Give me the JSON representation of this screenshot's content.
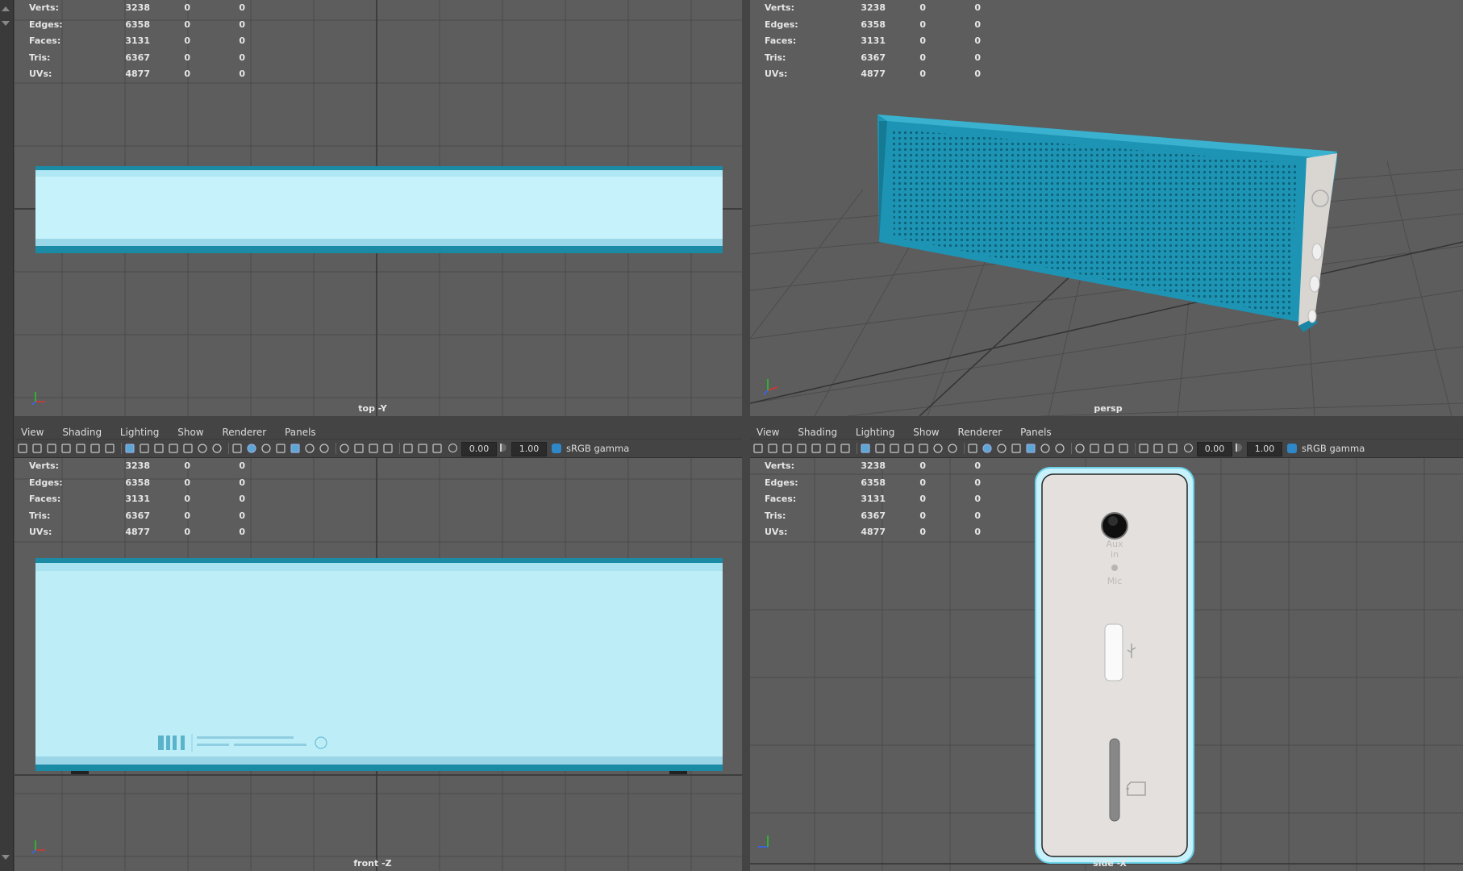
{
  "stats": {
    "rows": [
      {
        "label": "Verts:",
        "a": "3238",
        "b": "0",
        "c": "0"
      },
      {
        "label": "Edges:",
        "a": "6358",
        "b": "0",
        "c": "0"
      },
      {
        "label": "Faces:",
        "a": "3131",
        "b": "0",
        "c": "0"
      },
      {
        "label": "Tris:",
        "a": "6367",
        "b": "0",
        "c": "0"
      },
      {
        "label": "UVs:",
        "a": "4877",
        "b": "0",
        "c": "0"
      }
    ]
  },
  "viewports": {
    "top": {
      "camera": "top -Y"
    },
    "persp": {
      "camera": "persp"
    },
    "front": {
      "camera": "front -Z"
    },
    "side": {
      "camera": "side -X"
    }
  },
  "menu": {
    "view": "View",
    "shading": "Shading",
    "lighting": "Lighting",
    "show": "Show",
    "renderer": "Renderer",
    "panels": "Panels"
  },
  "toolbar": {
    "exposure": "0.00",
    "gamma": "1.00",
    "colorspace": "sRGB gamma"
  },
  "speaker": {
    "logo": "mi",
    "side_labels": {
      "aux": "Aux in",
      "mic": "Mic"
    }
  },
  "colors": {
    "accent": "#1a9cc0",
    "viewport_bg": "#5d5d5d",
    "ortho_fill": "#bdeef8"
  },
  "icons": [
    "camera-icon",
    "grid-icon",
    "wireframe-icon",
    "shaded-icon",
    "light-icon",
    "exposure-icon",
    "gamma-icon",
    "colorspace-icon",
    "usb-icon",
    "sd-card-icon",
    "axis-gizmo-icon",
    "power-button-icon"
  ]
}
